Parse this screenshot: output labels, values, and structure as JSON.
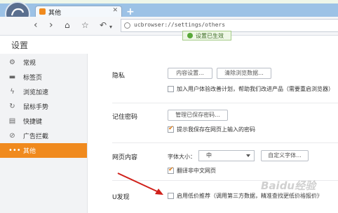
{
  "browser": {
    "tab_title": "其他",
    "address": "ucbrowser://settings/others",
    "toast": "设置已生效"
  },
  "page": {
    "title": "设置"
  },
  "sidebar": {
    "items": [
      {
        "label": "常规",
        "icon": "gear-icon"
      },
      {
        "label": "标签页",
        "icon": "tab-icon"
      },
      {
        "label": "浏览加速",
        "icon": "lightning-icon"
      },
      {
        "label": "鼠标手势",
        "icon": "gesture-icon"
      },
      {
        "label": "快捷键",
        "icon": "keyboard-icon"
      },
      {
        "label": "广告拦截",
        "icon": "block-icon"
      },
      {
        "label": "其他",
        "icon": "dots-icon"
      }
    ]
  },
  "privacy": {
    "label": "隐私",
    "content_settings": "内容设置...",
    "clear_data": "清除浏览数据...",
    "join_program": "加入用户体验改善计划，帮助我们改进产品（需要重启浏览器）"
  },
  "passwords": {
    "label": "记住密码",
    "manage": "管理已保存密码...",
    "prompt_save": "提示我保存在网页上输入的密码"
  },
  "webcontent": {
    "label": "网页内容",
    "font_size_label": "字体大小：",
    "font_size_value": "中",
    "custom_font": "自定义字体...",
    "translate": "翻译非中文网页"
  },
  "udiscover": {
    "label": "U发现",
    "option": "启用低价推荐（调用第三方数据，精准查找更低价格报价）"
  },
  "watermark": {
    "text": "Baidu经验",
    "sub": "jingyan.baidu.com"
  }
}
